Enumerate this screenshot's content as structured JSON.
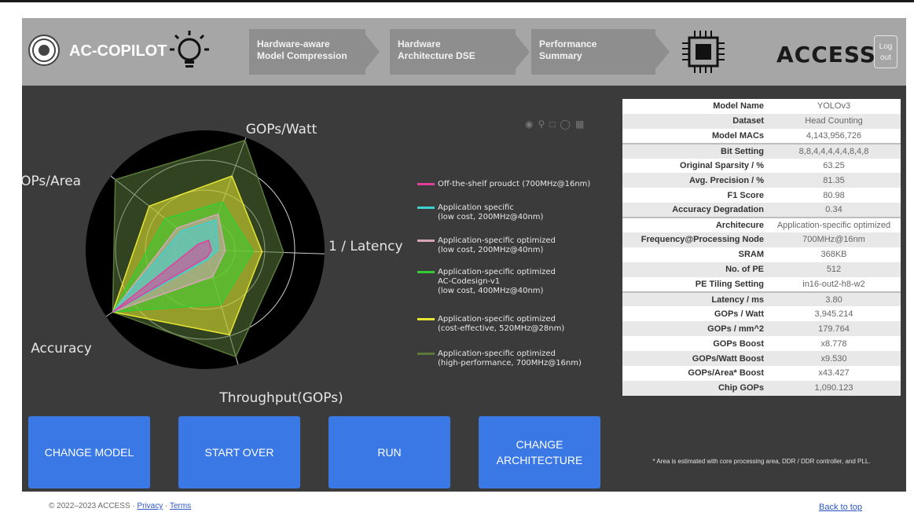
{
  "header": {
    "app_title": "AC-COPILOT",
    "steps": [
      "Hardware-aware\nModel Compression",
      "Hardware\nArchitecture DSE",
      "Performance\nSummary"
    ],
    "brand": "ACCESS",
    "logout_label": "Log out"
  },
  "chart_data": {
    "type": "radar",
    "axes": [
      "GOPs/Watt",
      "1 / Latency",
      "Throughput(GOPs)",
      "Accuracy",
      "GOPs/Area"
    ],
    "rlim": [
      0,
      1
    ],
    "series": [
      {
        "name": "Off-the-shelf proudct (700MHz@16nm)",
        "color": "#e0409a",
        "values": [
          0.08,
          0.05,
          0.06,
          0.88,
          0.07
        ]
      },
      {
        "name": "Application specific\n(low cost, 200MHz@40nm)",
        "color": "#3fd0d0",
        "values": [
          0.25,
          0.1,
          0.08,
          0.88,
          0.24
        ]
      },
      {
        "name": "Application-specific optimized\n(low cost, 200MHz@40nm)",
        "color": "#d6a6b8",
        "values": [
          0.3,
          0.16,
          0.22,
          0.88,
          0.28
        ]
      },
      {
        "name": "Application-specific optimized\nAC-Codesign-v1\n(low cost, 400MHz@40nm)",
        "color": "#33cc33",
        "values": [
          0.4,
          0.38,
          0.45,
          0.88,
          0.4
        ]
      },
      {
        "name": "Application-specific optimized\n(cost-effective, 520MHz@28nm)",
        "color": "#e6e633",
        "values": [
          0.62,
          0.45,
          0.7,
          0.88,
          0.56
        ]
      },
      {
        "name": "Application-specific optimized\n(high-performance, 700MHz@16nm)",
        "color": "#5a7a3a",
        "values": [
          0.92,
          0.62,
          0.88,
          0.88,
          0.9
        ]
      }
    ]
  },
  "toolbar_icons": [
    "camera-icon",
    "zoom-icon",
    "select-icon",
    "lasso-icon",
    "bar-icon"
  ],
  "table": {
    "rows": [
      {
        "k": "Model Name",
        "v": "YOLOv3"
      },
      {
        "k": "Dataset",
        "v": "Head Counting"
      },
      {
        "k": "Model MACs",
        "v": "4,143,956,726"
      },
      {
        "k": "Bit Setting",
        "v": "8,8,4,4,4,4,4,8,4,8"
      },
      {
        "k": "Original Sparsity / %",
        "v": "63.25"
      },
      {
        "k": "Avg. Precision / %",
        "v": "81.35"
      },
      {
        "k": "F1 Score",
        "v": "80.98"
      },
      {
        "k": "Accuracy Degradation",
        "v": "0.34"
      },
      {
        "k": "Architecure",
        "v": "Application-specific optimized"
      },
      {
        "k": "Frequency@Processing Node",
        "v": "700MHz@16nm"
      },
      {
        "k": "SRAM",
        "v": "368KB"
      },
      {
        "k": "No. of PE",
        "v": "512"
      },
      {
        "k": "PE Tiling Setting",
        "v": "in16-out2-h8-w2"
      },
      {
        "k": "Latency / ms",
        "v": "3.80"
      },
      {
        "k": "GOPs / Watt",
        "v": "3,945.214"
      },
      {
        "k": "GOPs / mm^2",
        "v": "179.764"
      },
      {
        "k": "GOPs Boost",
        "v": "x8.778"
      },
      {
        "k": "GOPs/Watt Boost",
        "v": "x9.530"
      },
      {
        "k": "GOPs/Area* Boost",
        "v": "x43.427"
      },
      {
        "k": "Chip GOPs",
        "v": "1,090.123"
      }
    ]
  },
  "note": "* Area is estimated with core processing area, DDR / DDR controller, and PLL.",
  "buttons": {
    "change_model": "CHANGE MODEL",
    "start_over": "START OVER",
    "run": "RUN",
    "change_arch": "CHANGE ARCHITECTURE"
  },
  "footer": {
    "copyright": "© 2022–2023 ACCESS · ",
    "privacy": "Privacy",
    "sep": " · ",
    "terms": "Terms",
    "back_to_top": "Back to top"
  }
}
